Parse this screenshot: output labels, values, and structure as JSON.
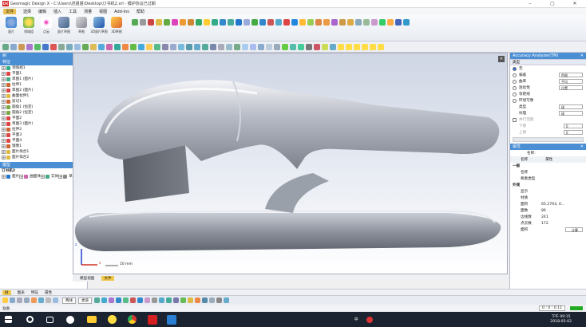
{
  "title": "Geomagic Design X - C:\\Users\\范姐姐\\Desktop\\订书机2.xrl - 模护协议已过期",
  "app_logo": "DX",
  "menu": [
    "文件",
    "选择",
    "编辑",
    "插入",
    "工具",
    "测量",
    "视图",
    "Add-Ins",
    "帮助"
  ],
  "ribbon_buttons": [
    "面片",
    "领域组",
    "点云",
    "面片草图",
    "草图",
    "3D面片草图",
    "3D草图"
  ],
  "left_panel": {
    "title": "树",
    "features_header": "特征",
    "features": [
      "领域组1",
      "平面1",
      "草图1 (面片)",
      "拉伸1",
      "草图2 (面片)",
      "曲面拉伸1",
      "剪切1",
      "圆角1 (恒定)",
      "圆角2 (恒定)",
      "平面2",
      "草图3 (面片)",
      "拉伸2",
      "平面3",
      "平面4",
      "镜像1",
      "面片拟合1",
      "面片拟合2"
    ],
    "model_header": "模型",
    "model_root": "订书机2",
    "model_items": [
      "面片",
      "曲面体",
      "实体",
      "草图",
      "参照线",
      "参照平面",
      "参照坐标系"
    ]
  },
  "viewport": {
    "scale_label": "10 mm",
    "axis_z": "z",
    "axis_x": "x"
  },
  "right_panel": {
    "title": "Accuracy Analyzer(TM)",
    "type_label": "类型",
    "options": [
      "无",
      "偏差",
      "曲率",
      "连续性",
      "等距线",
      "环境写像"
    ],
    "dd1": "色图",
    "dd2": "平均",
    "dd3": "位置",
    "type2_label": "类型",
    "type2_value": "球",
    "texture_label": "纹理",
    "texture_value": "球",
    "slider_label": "并行范围",
    "min_label": "下限",
    "max_label": "上限",
    "min_value": "0",
    "max_value": "0",
    "unit": "mm",
    "props_title": "属性",
    "props_name": "名称:",
    "col_name": "名称",
    "col_prop": "属性",
    "general": "一般",
    "name_row": "名称",
    "show_type": "要素类型",
    "appearance": "外观",
    "display": "显示",
    "material": "材质",
    "stats": [
      {
        "k": "面积",
        "v": "65.2793, 0..."
      },
      {
        "k": "面数",
        "v": "86"
      },
      {
        "k": "边线数",
        "v": "241"
      },
      {
        "k": "点云数",
        "v": "172"
      }
    ],
    "volume_label": "面积",
    "calc_button": "计算"
  },
  "view_tabs": [
    "模型视图",
    "文件"
  ],
  "bottom_tabs": [
    "树",
    "图表",
    "特征",
    "属性"
  ],
  "bottom_tool": {
    "dd1": "两线",
    "dd2": "类值"
  },
  "status": "准备",
  "status_right": "0 : 0 : 0.11",
  "clock": {
    "time": "下午 09:15",
    "date": "2018-05-02"
  },
  "ime": "中"
}
